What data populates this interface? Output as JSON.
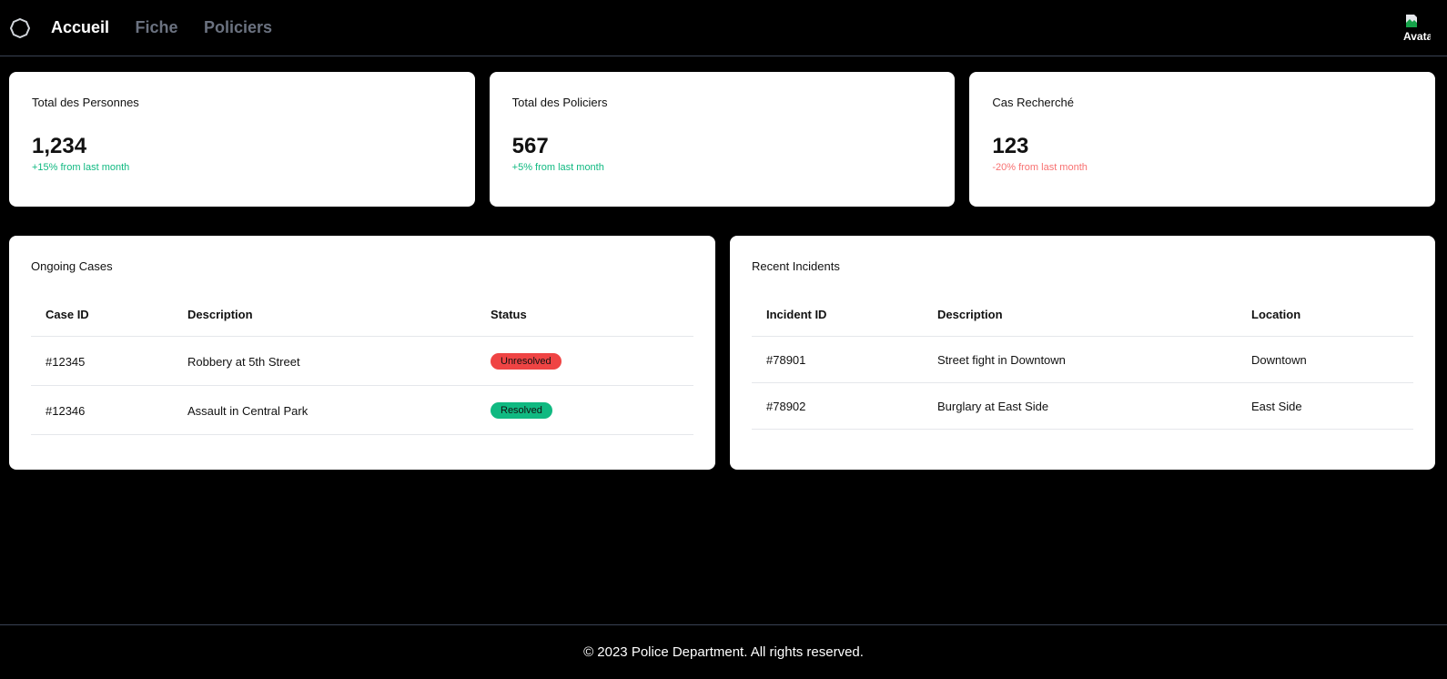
{
  "nav": {
    "logo_icon": "circle-logo-icon",
    "items": [
      {
        "label": "Accueil",
        "active": true
      },
      {
        "label": "Fiche",
        "active": false
      },
      {
        "label": "Policiers",
        "active": false
      }
    ],
    "avatar_alt": "Avatar"
  },
  "stats": [
    {
      "title": "Total des Personnes",
      "value": "1,234",
      "change": "+15% from last month",
      "trend": "positive"
    },
    {
      "title": "Total des Policiers",
      "value": "567",
      "change": "+5% from last month",
      "trend": "positive"
    },
    {
      "title": "Cas Recherché",
      "value": "123",
      "change": "-20% from last month",
      "trend": "negative"
    }
  ],
  "ongoing_cases": {
    "title": "Ongoing Cases",
    "columns": [
      "Case ID",
      "Description",
      "Status"
    ],
    "rows": [
      {
        "id": "#12345",
        "description": "Robbery at 5th Street",
        "status": "Unresolved"
      },
      {
        "id": "#12346",
        "description": "Assault in Central Park",
        "status": "Resolved"
      }
    ]
  },
  "recent_incidents": {
    "title": "Recent Incidents",
    "columns": [
      "Incident ID",
      "Description",
      "Location"
    ],
    "rows": [
      {
        "id": "#78901",
        "description": "Street fight in Downtown",
        "location": "Downtown"
      },
      {
        "id": "#78902",
        "description": "Burglary at East Side",
        "location": "East Side"
      }
    ]
  },
  "footer": {
    "text": "© 2023 Police Department. All rights reserved."
  },
  "colors": {
    "positive": "#10b981",
    "negative": "#f87171",
    "unresolved_badge": "#ef4444",
    "resolved_badge": "#10b981",
    "nav_inactive": "#6b7280"
  }
}
